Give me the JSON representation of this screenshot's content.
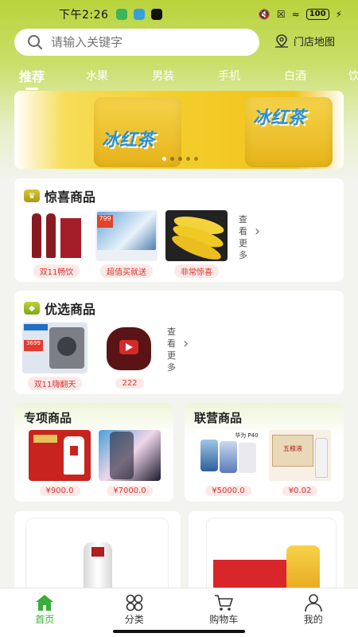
{
  "status_bar": {
    "time": "下午2:26",
    "battery": "100"
  },
  "search": {
    "placeholder": "请输入关键字",
    "store_map_label": "门店地图"
  },
  "category_tabs": [
    "推荐",
    "水果",
    "男装",
    "手机",
    "白酒",
    "饮"
  ],
  "banner": {
    "logo_text": "冰红茶",
    "dots_total": 5,
    "active_dot": 1
  },
  "surprise_section": {
    "title": "惊喜商品",
    "products": [
      {
        "tag": "双11畅饮",
        "image": "red wine bottles"
      },
      {
        "tag": "超值买就送",
        "image": "television"
      },
      {
        "tag": "非常惊喜",
        "image": "bananas"
      }
    ],
    "more_label": "查看更多"
  },
  "selected_section": {
    "title": "优选商品",
    "products": [
      {
        "tag": "双11嗨翻天",
        "image": "washing machine",
        "price_badge": "3699"
      },
      {
        "tag": "222",
        "image": "video thumbnail"
      }
    ],
    "more_label": "查看更多"
  },
  "special_section": {
    "title": "专项商品",
    "products": [
      {
        "price": "¥900.0",
        "image": "liquor gift box"
      },
      {
        "price": "¥7000.0",
        "image": "phone"
      }
    ]
  },
  "joint_section": {
    "title": "联营商品",
    "products": [
      {
        "price": "¥5000.0",
        "image": "huawei phone",
        "badge": "华为 P40"
      },
      {
        "price": "¥0.02",
        "image": "baijiu box",
        "badge": "五粮液"
      }
    ]
  },
  "bottom_nav": [
    {
      "label": "首页",
      "icon": "home-icon",
      "active": true
    },
    {
      "label": "分类",
      "icon": "category-icon",
      "active": false
    },
    {
      "label": "购物车",
      "icon": "cart-icon",
      "active": false
    },
    {
      "label": "我的",
      "icon": "user-icon",
      "active": false
    }
  ],
  "colors": {
    "accent": "#3aae3a",
    "header": "#b9d33c",
    "price": "#d9312b"
  }
}
